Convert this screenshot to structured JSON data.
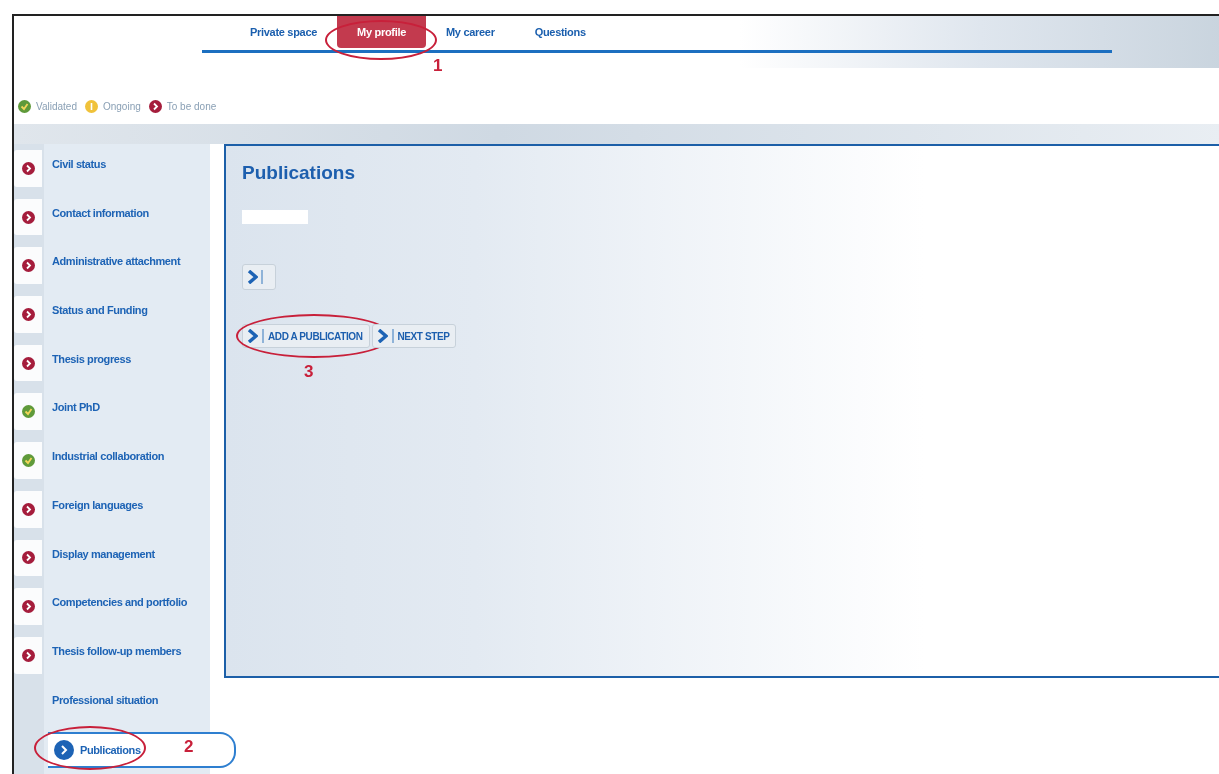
{
  "nav": {
    "tabs": [
      {
        "label": "Private space",
        "selected": false
      },
      {
        "label": "My profile",
        "selected": true,
        "callout": "1"
      },
      {
        "label": "My career",
        "selected": false
      },
      {
        "label": "Questions",
        "selected": false
      }
    ]
  },
  "legend": [
    {
      "kind": "validated",
      "label": "Validated"
    },
    {
      "kind": "ongoing",
      "label": "Ongoing"
    },
    {
      "kind": "todo",
      "label": "To be done"
    }
  ],
  "sidebar": {
    "items": [
      {
        "label": "Civil status",
        "kind": "todo",
        "selected": false
      },
      {
        "label": "Contact information",
        "kind": "todo",
        "selected": false
      },
      {
        "label": "Administrative attachment",
        "kind": "todo",
        "selected": false
      },
      {
        "label": "Status and Funding",
        "kind": "todo",
        "selected": false
      },
      {
        "label": "Thesis progress",
        "kind": "todo",
        "selected": false
      },
      {
        "label": "Joint PhD",
        "kind": "validated",
        "selected": false
      },
      {
        "label": "Industrial collaboration",
        "kind": "validated",
        "selected": false
      },
      {
        "label": "Foreign languages",
        "kind": "todo",
        "selected": false
      },
      {
        "label": "Display management",
        "kind": "todo",
        "selected": false
      },
      {
        "label": "Competencies and portfolio",
        "kind": "todo",
        "selected": false
      },
      {
        "label": "Thesis follow-up members",
        "kind": "todo",
        "selected": false
      },
      {
        "label": "Professional situation",
        "kind": "plain",
        "selected": false
      },
      {
        "label": "Publications",
        "kind": "current",
        "selected": true,
        "callout": "2"
      }
    ]
  },
  "main": {
    "title": "Publications",
    "buttons": [
      {
        "label": "ADD A PUBLICATION",
        "callout": "3"
      },
      {
        "label": "NEXT STEP"
      }
    ]
  }
}
